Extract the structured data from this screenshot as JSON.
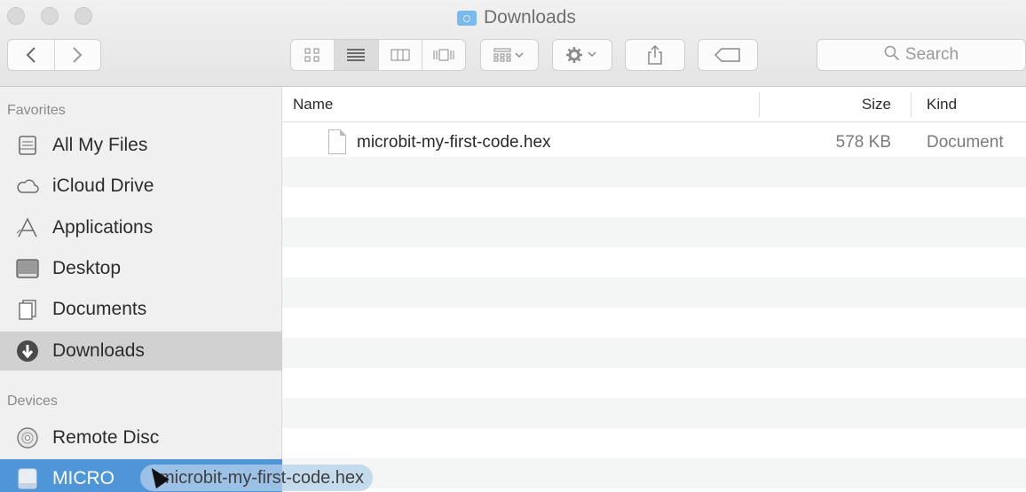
{
  "window": {
    "title": "Downloads",
    "title_icon": "downloads-folder-icon"
  },
  "toolbar": {
    "back_icon": "chevron-left-icon",
    "forward_icon": "chevron-right-icon",
    "view_icon": "icon-view-icon",
    "list_icon": "list-view-icon",
    "column_icon": "column-view-icon",
    "coverflow_icon": "cover-flow-icon",
    "arrange_icon": "arrange-icon",
    "action_icon": "gear-icon",
    "share_icon": "share-icon",
    "tag_icon": "tag-icon",
    "search_placeholder": "Search",
    "search_icon": "search-icon"
  },
  "sidebar": {
    "favorites_header": "Favorites",
    "devices_header": "Devices",
    "favorites": [
      {
        "label": "All My Files",
        "icon": "all-files-icon"
      },
      {
        "label": "iCloud Drive",
        "icon": "cloud-icon"
      },
      {
        "label": "Applications",
        "icon": "applications-icon"
      },
      {
        "label": "Desktop",
        "icon": "desktop-icon"
      },
      {
        "label": "Documents",
        "icon": "documents-icon"
      },
      {
        "label": "Downloads",
        "icon": "downloads-icon",
        "selected": true
      }
    ],
    "devices": [
      {
        "label": "Remote Disc",
        "icon": "disc-icon"
      },
      {
        "label": "MICRO",
        "icon": "drive-icon",
        "drop_target": true
      }
    ]
  },
  "file_list": {
    "columns": {
      "name": "Name",
      "size": "Size",
      "kind": "Kind"
    },
    "rows": [
      {
        "name": "microbit-my-first-code.hex",
        "size": "578 KB",
        "kind": "Document",
        "icon": "document-icon"
      }
    ]
  },
  "drag": {
    "label": "microbit-my-first-code.hex",
    "icon": "cursor-arrow-icon"
  },
  "colors": {
    "selection_gray": "#d1d1d1",
    "drop_blue": "#4f96d9",
    "sidebar_bg": "#f0f0f0"
  }
}
